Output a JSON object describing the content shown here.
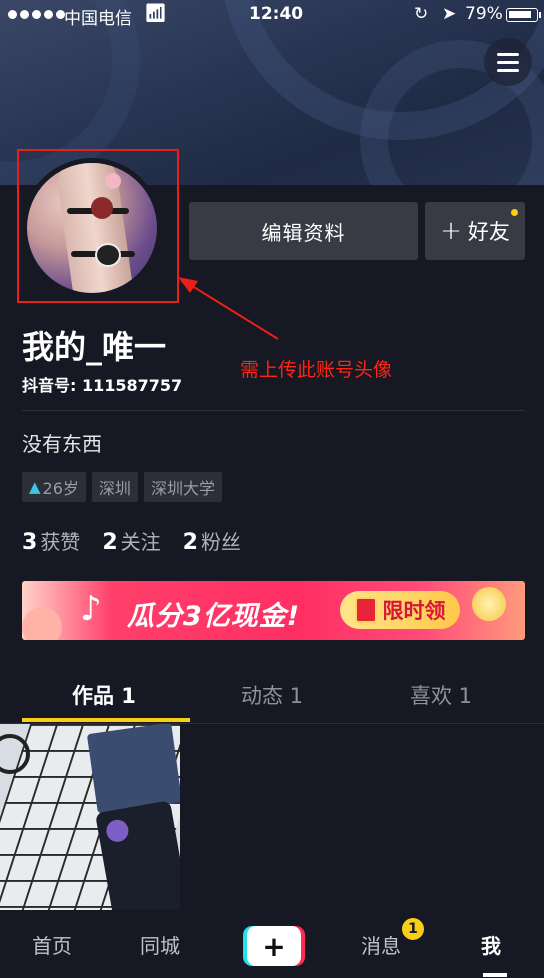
{
  "status_bar": {
    "carrier": "中国电信",
    "time": "12:40",
    "battery": "79%"
  },
  "profile": {
    "nickname": "我的_唯一",
    "douyin_id": "抖音号: 111587757",
    "bio": "没有东西",
    "edit_button": "编辑资料",
    "add_friend_button": "好友",
    "add_friend_plus": "+"
  },
  "annotation": {
    "text": "需上传此账号头像",
    "color": "#ff2416"
  },
  "tags": [
    {
      "label": "26岁",
      "icon": "person-icon"
    },
    {
      "label": "深圳"
    },
    {
      "label": "深圳大学"
    }
  ],
  "stats": [
    {
      "count": "3",
      "label": "获赞"
    },
    {
      "count": "2",
      "label": "关注"
    },
    {
      "count": "2",
      "label": "粉丝"
    }
  ],
  "banner": {
    "text": "瓜分3亿现金!",
    "pill": "限时领"
  },
  "tabs": [
    {
      "label": "作品 1",
      "active": true
    },
    {
      "label": "动态 1",
      "active": false
    },
    {
      "label": "喜欢 1",
      "active": false
    }
  ],
  "bottom_nav": {
    "home": "首页",
    "nearby": "同城",
    "add": "+",
    "messages": "消息",
    "messages_badge": "1",
    "me": "我"
  },
  "colors": {
    "background": "#161823",
    "accent": "#face15",
    "brand_red": "#fe2c55",
    "brand_cyan": "#26e0e8"
  }
}
